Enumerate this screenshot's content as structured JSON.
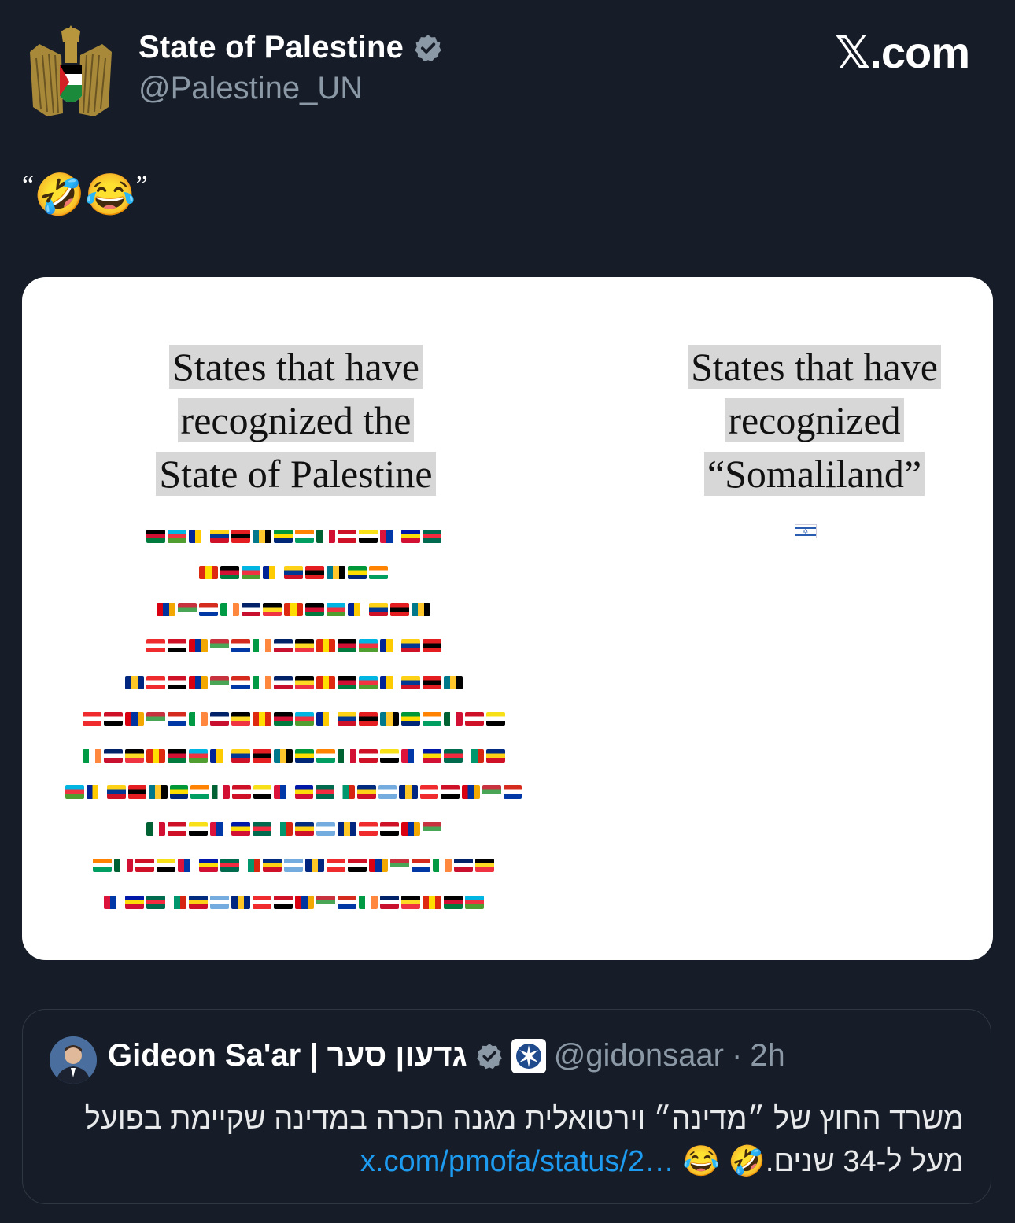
{
  "author": {
    "display_name": "State of Palestine",
    "handle": "@Palestine_UN",
    "avatar_icon": "palestine-eagle-emblem-icon",
    "verified_icon": "verified-badge-icon"
  },
  "brand": {
    "label_x": "𝕏",
    "label_rest": ".com"
  },
  "tweet": {
    "open_quote": "“",
    "emoji_1": "🤣",
    "emoji_2": "😂",
    "close_quote": "”"
  },
  "media": {
    "left_title": [
      "States that have",
      "recognized the",
      "State of Palestine"
    ],
    "right_title": [
      "States that have",
      "recognized",
      "“Somaliland”"
    ],
    "left_flag_count_per_row": [
      14,
      9,
      13,
      14,
      16,
      20,
      20,
      22,
      14,
      19,
      18
    ],
    "right_flag_icon": "israel-flag-icon"
  },
  "quoted_tweet": {
    "display_name": "Gideon Sa'ar | גדעון סער",
    "handle": "@gidonsaar",
    "separator": "·",
    "time": "2h",
    "text_line1": "משרד החוץ של ״מדינה״ וירטואלית מגנה הכרה במדינה שקיימת בפועל",
    "text_line2": "מעל ל-34 שנים.",
    "emoji_1": "🤣",
    "emoji_2": "😂",
    "link": "x.com/pmofa/status/2…",
    "colors": {
      "link": "#1d9bf0"
    }
  },
  "colors": {
    "background": "#171d28",
    "muted": "#8b98a5",
    "verified": "#8b98a5"
  }
}
